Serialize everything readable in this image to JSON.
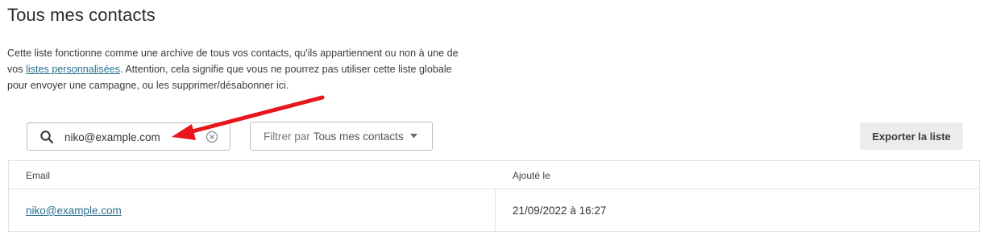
{
  "page": {
    "title": "Tous mes contacts",
    "description_before": "Cette liste fonctionne comme une archive de tous vos contacts, qu'ils appartiennent ou non à une de vos ",
    "description_link": "listes personnalisées",
    "description_after": ". Attention, cela signifie que vous ne pourrez pas utiliser cette liste globale pour envoyer une campagne, ou les supprimer/désabonner ici."
  },
  "search": {
    "value": "niko@example.com",
    "icon": "search-icon",
    "clear_icon": "clear-circle-x-icon"
  },
  "filter": {
    "label": "Filtrer par",
    "value": "Tous mes contacts",
    "icon": "caret-down-icon"
  },
  "toolbar": {
    "export_label": "Exporter la liste"
  },
  "table": {
    "columns": [
      "Email",
      "Ajouté le"
    ],
    "rows": [
      {
        "email": "niko@example.com",
        "added": "21/09/2022 à 16:27"
      }
    ]
  },
  "annotation": {
    "arrow_color": "#e8151b"
  }
}
